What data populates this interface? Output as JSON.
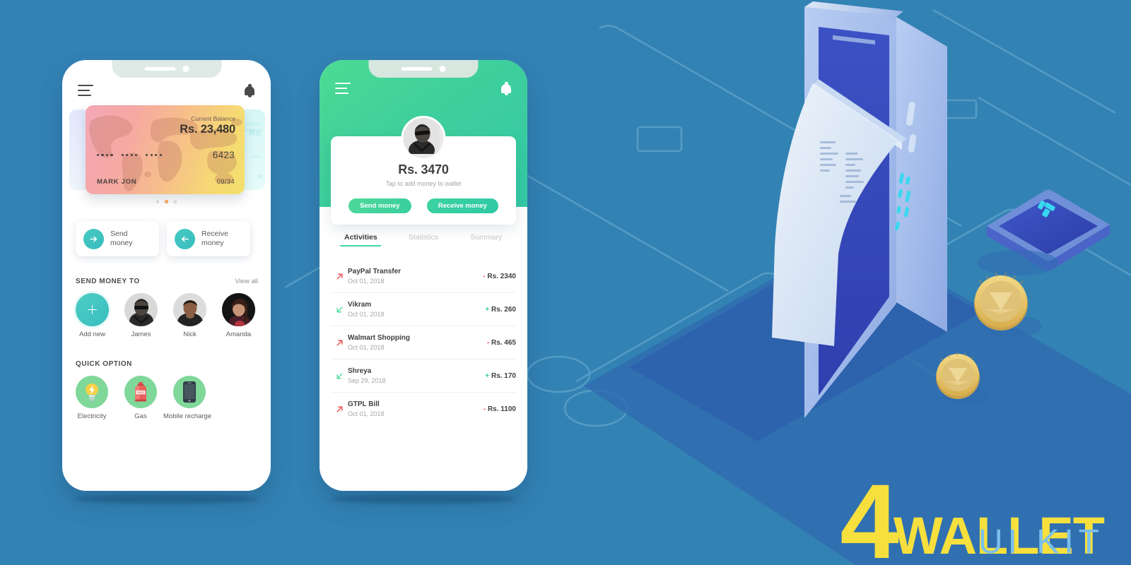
{
  "meta": {
    "background_color": "#3382b4",
    "accent_teal": "#3ec6c0",
    "accent_green": "#3ed79c",
    "logo_yellow": "#f7e03d",
    "logo_blue": "#7bc0ec"
  },
  "logo": {
    "numeral": "4",
    "word": "WALLET",
    "subtitle": "UI KIT"
  },
  "phone1": {
    "statusbar": {
      "menu_icon": "hamburger-icon",
      "bell_icon": "bell-icon"
    },
    "card": {
      "balance_label": "Current Balance",
      "balance_value": "Rs. 23,480",
      "masked_groups": [
        "••••",
        "••••",
        "••••"
      ],
      "last_four": "6423",
      "holder_name": "MARK JON",
      "expiry": "09/34"
    },
    "carousel": {
      "dots_total": 3,
      "active_index": 1,
      "peek_right_ghost": {
        "label": "Current Balance",
        "value": "Rs.",
        "holder": "M"
      }
    },
    "actions": [
      {
        "label_line1": "Send",
        "label_line2": "money",
        "icon": "arrow-right-icon"
      },
      {
        "label_line1": "Receive",
        "label_line2": "money",
        "icon": "arrow-left-icon"
      }
    ],
    "send_money_to": {
      "title": "SEND MONEY TO",
      "view_all": "View all",
      "people": [
        {
          "name": "Add new",
          "type": "add"
        },
        {
          "name": "James",
          "type": "avatar"
        },
        {
          "name": "Nick",
          "type": "avatar"
        },
        {
          "name": "Amanda",
          "type": "avatar"
        }
      ]
    },
    "quick_option": {
      "title": "QUICK OPTION",
      "items": [
        {
          "name": "Electricity",
          "icon": "lightbulb-icon"
        },
        {
          "name": "Gas",
          "icon": "gas-cylinder-icon",
          "badge": "GAS"
        },
        {
          "name": "Mobile recharge",
          "icon": "mobile-phone-icon"
        }
      ]
    }
  },
  "phone2": {
    "statusbar": {
      "menu_icon": "hamburger-icon",
      "bell_icon": "bell-icon"
    },
    "wallet": {
      "amount": "Rs. 3470",
      "subtitle": "Tap to add money to wallet",
      "send_label": "Send money",
      "receive_label": "Receive money"
    },
    "tabs": [
      {
        "label": "Activities",
        "active": true
      },
      {
        "label": "Statistics",
        "active": false
      },
      {
        "label": "Summary",
        "active": false
      }
    ],
    "transactions": [
      {
        "title": "PayPal Transfer",
        "date": "Oct 01, 2018",
        "sign": "-",
        "amount": "Rs. 2340",
        "direction": "out"
      },
      {
        "title": "Vikram",
        "date": "Oct 01, 2018",
        "sign": "+",
        "amount": "Rs. 260",
        "direction": "in"
      },
      {
        "title": "Walmart Shopping",
        "date": "Oct 01, 2018",
        "sign": "-",
        "amount": "Rs. 465",
        "direction": "out"
      },
      {
        "title": "Shreya",
        "date": "Sep 29, 2018",
        "sign": "+",
        "amount": "Rs. 170",
        "direction": "in"
      },
      {
        "title": "GTPL Bill",
        "date": "Oct 01, 2018",
        "sign": "-",
        "amount": "Rs. 1100",
        "direction": "out"
      }
    ]
  }
}
